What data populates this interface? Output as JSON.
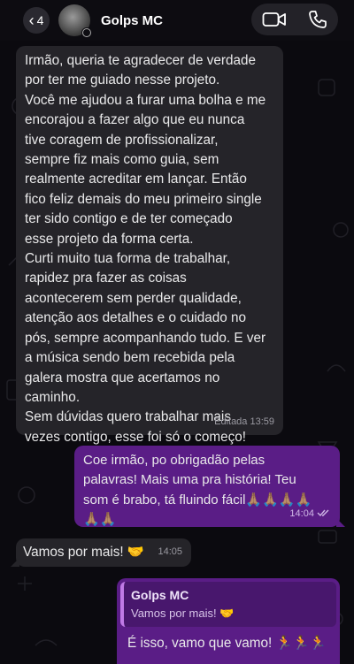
{
  "header": {
    "back_count": "4",
    "contact_name": "Golps MC",
    "icons": [
      "chevron-left-icon",
      "video-call-icon",
      "phone-icon"
    ]
  },
  "messages": [
    {
      "direction": "incoming",
      "lines": [
        "Irmão, queria te agradecer de verdade",
        "por ter me guiado nesse projeto.",
        "Você me ajudou a furar uma bolha e me",
        "encorajou a fazer algo que eu nunca",
        "tive coragem de profissionalizar,",
        "sempre fiz mais como guia, sem",
        "realmente acreditar em lançar. Então",
        "fico feliz demais do meu primeiro single",
        "ter sido contigo e de ter começado",
        "esse projeto da forma certa.",
        "Curti muito tua forma de trabalhar,",
        "rapidez pra fazer as coisas",
        "acontecerem sem perder qualidade,",
        "atenção aos detalhes e o cuidado no",
        "pós, sempre acompanhando tudo. E ver",
        "a música sendo bem recebida pela",
        "galera mostra que acertamos no",
        "caminho.",
        "Sem dúvidas quero trabalhar mais",
        "vezes contigo, esse foi só o começo!"
      ],
      "time": "Editada 13:59"
    },
    {
      "direction": "outgoing",
      "lines": [
        "Coe irmão, po obrigadão pelas",
        "palavras! Mais uma pra história! Teu",
        "som é brabo, tá fluindo fácil🙏🏽🙏🏽🙏🏽🙏🏽",
        "🙏🏽🙏🏽"
      ],
      "time": "14:04",
      "status": "read"
    },
    {
      "direction": "incoming",
      "text": "Vamos por mais! 🤝",
      "time": "14:05"
    },
    {
      "direction": "outgoing",
      "quote": {
        "name": "Golps MC",
        "text": "Vamos por mais! 🤝"
      },
      "text": "É isso, vamo que vamo! 🏃🏃🏃"
    }
  ],
  "colors": {
    "incoming_bubble": "#252429",
    "outgoing_bubble": "#5a1d86",
    "quote_bar": "#c07ae6",
    "background": "#0b0a0f"
  }
}
